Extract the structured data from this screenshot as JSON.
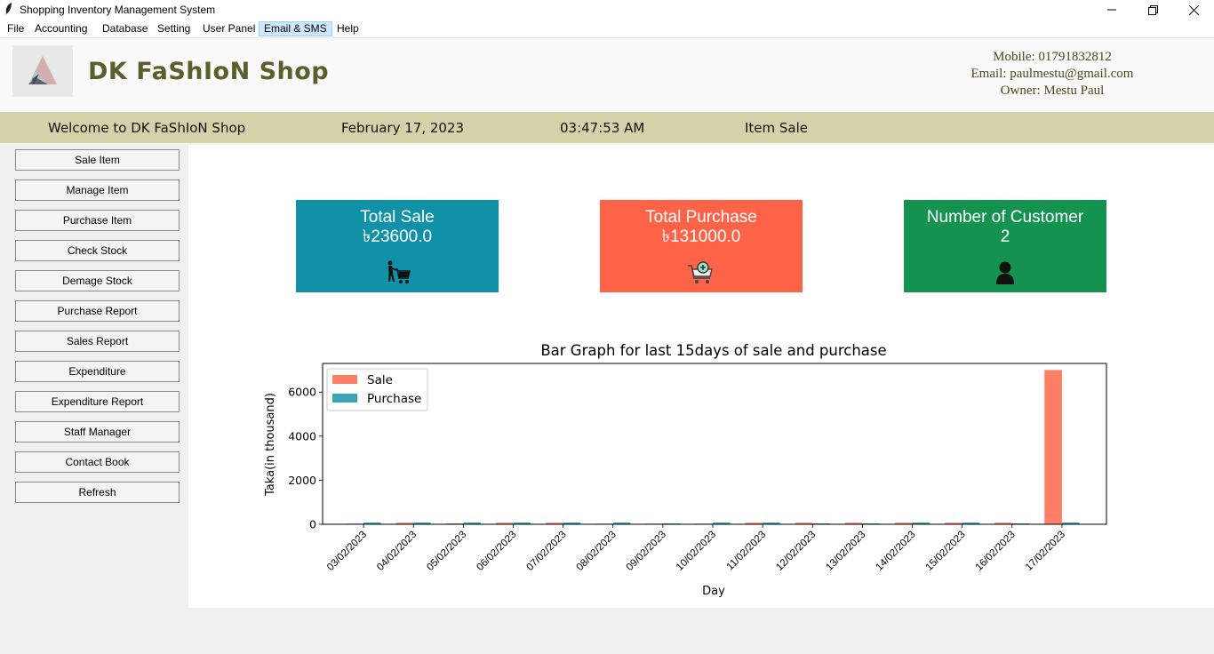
{
  "window": {
    "title": "Shopping Inventory Management System"
  },
  "menu": [
    "File",
    "Accounting",
    "Database",
    "Setting",
    "User Panel",
    "Email & SMS",
    "Help"
  ],
  "header": {
    "shop_name": "DK FaShIoN Shop",
    "mobile": "Mobile: 01791832812",
    "email": "Email: paulmestu@gmail.com",
    "owner": "Owner: Mestu Paul"
  },
  "status": {
    "welcome": "Welcome to DK FaShIoN Shop",
    "date": "February 17, 2023",
    "time": "03:47:53 AM",
    "page": "Item Sale"
  },
  "sidebar": [
    "Sale Item",
    "Manage Item",
    "Purchase Item",
    "Check Stock",
    "Demage Stock",
    "Purchase Report",
    "Sales Report",
    "Expenditure",
    "Expenditure Report",
    "Staff Manager",
    "Contact Book",
    "Refresh"
  ],
  "cards": {
    "sale": {
      "title": "Total Sale",
      "value": "৳23600.0",
      "color": "#1191a8",
      "icon": "person-cart-icon"
    },
    "purchase": {
      "title": "Total Purchase",
      "value": "৳131000.0",
      "color": "#ff6347",
      "icon": "cart-plus-icon"
    },
    "customer": {
      "title": "Number of Customer",
      "value": "2",
      "color": "#13934f",
      "icon": "user-icon"
    }
  },
  "chart_data": {
    "type": "bar",
    "title": "Bar Graph for last 15days of sale and purchase",
    "xlabel": "Day",
    "ylabel": "Taka(in thousand)",
    "ylim": [
      0,
      7300
    ],
    "yticks": [
      0,
      2000,
      4000,
      6000
    ],
    "categories": [
      "03/02/2023",
      "04/02/2023",
      "05/02/2023",
      "06/02/2023",
      "07/02/2023",
      "08/02/2023",
      "09/02/2023",
      "10/02/2023",
      "11/02/2023",
      "12/02/2023",
      "13/02/2023",
      "14/02/2023",
      "15/02/2023",
      "16/02/2023",
      "17/02/2023"
    ],
    "series": [
      {
        "name": "Sale",
        "color": "#ff7f66",
        "values": [
          30,
          70,
          40,
          70,
          70,
          30,
          30,
          30,
          70,
          70,
          70,
          70,
          70,
          70,
          7000
        ]
      },
      {
        "name": "Purchase",
        "color": "#3ea3b4",
        "values": [
          80,
          80,
          80,
          80,
          80,
          80,
          40,
          80,
          80,
          40,
          40,
          80,
          80,
          40,
          80
        ]
      }
    ],
    "legend": "top-left",
    "grid": false
  }
}
